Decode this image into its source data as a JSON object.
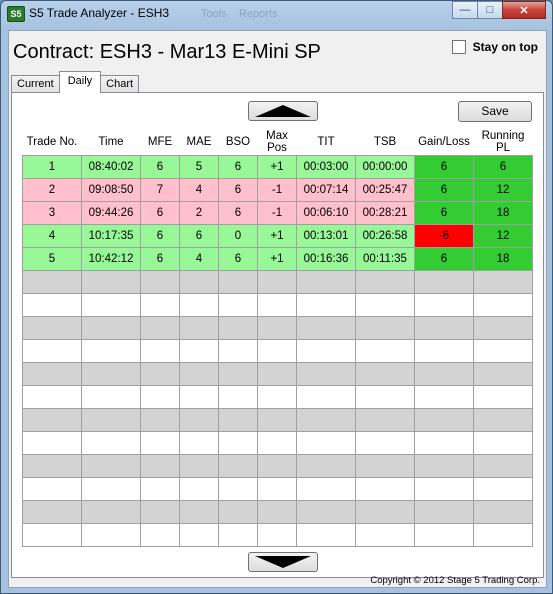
{
  "window": {
    "title": "S5 Trade Analyzer - ESH3",
    "icon_text": "S5",
    "ghost_menu": [
      "Tools",
      "Reports"
    ],
    "minimize_glyph": "—",
    "maximize_glyph": "□",
    "close_glyph": "✕"
  },
  "header": {
    "contract": "Contract: ESH3 - Mar13 E-Mini SP",
    "stay_on_top_label": "Stay on top",
    "stay_on_top_checked": false
  },
  "tabs": [
    {
      "label": "Current",
      "active": false
    },
    {
      "label": "Daily",
      "active": true
    },
    {
      "label": "Chart",
      "active": false
    }
  ],
  "toolbar": {
    "save_label": "Save"
  },
  "columns": [
    "Trade No.",
    "Time",
    "MFE",
    "MAE",
    "BSO",
    "Max Pos",
    "TIT",
    "TSB",
    "Gain/Loss",
    "Running PL"
  ],
  "trades": [
    {
      "no": "1",
      "time": "08:40:02",
      "mfe": "6",
      "mae": "5",
      "bso": "6",
      "maxpos": "+1",
      "tit": "00:03:00",
      "tsb": "00:00:00",
      "gain": "6",
      "running": "6",
      "row_color": "green",
      "gain_color": "green"
    },
    {
      "no": "2",
      "time": "09:08:50",
      "mfe": "7",
      "mae": "4",
      "bso": "6",
      "maxpos": "-1",
      "tit": "00:07:14",
      "tsb": "00:25:47",
      "gain": "6",
      "running": "12",
      "row_color": "pink",
      "gain_color": "green"
    },
    {
      "no": "3",
      "time": "09:44:26",
      "mfe": "6",
      "mae": "2",
      "bso": "6",
      "maxpos": "-1",
      "tit": "00:06:10",
      "tsb": "00:28:21",
      "gain": "6",
      "running": "18",
      "row_color": "pink",
      "gain_color": "green"
    },
    {
      "no": "4",
      "time": "10:17:35",
      "mfe": "6",
      "mae": "6",
      "bso": "0",
      "maxpos": "+1",
      "tit": "00:13:01",
      "tsb": "00:26:58",
      "gain": "-6",
      "running": "12",
      "row_color": "green",
      "gain_color": "red"
    },
    {
      "no": "5",
      "time": "10:42:12",
      "mfe": "6",
      "mae": "4",
      "bso": "6",
      "maxpos": "+1",
      "tit": "00:16:36",
      "tsb": "00:11:35",
      "gain": "6",
      "running": "18",
      "row_color": "green",
      "gain_color": "green"
    }
  ],
  "empty_row_count": 12,
  "footer": {
    "copyright": "Copyright © 2012 Stage 5 Trading Corp."
  },
  "colors": {
    "long_row": "#98f898",
    "short_row": "#ffc0cb",
    "gain_positive": "#33cc33",
    "gain_negative": "#ff0000",
    "running_pl": "#33cc33"
  }
}
